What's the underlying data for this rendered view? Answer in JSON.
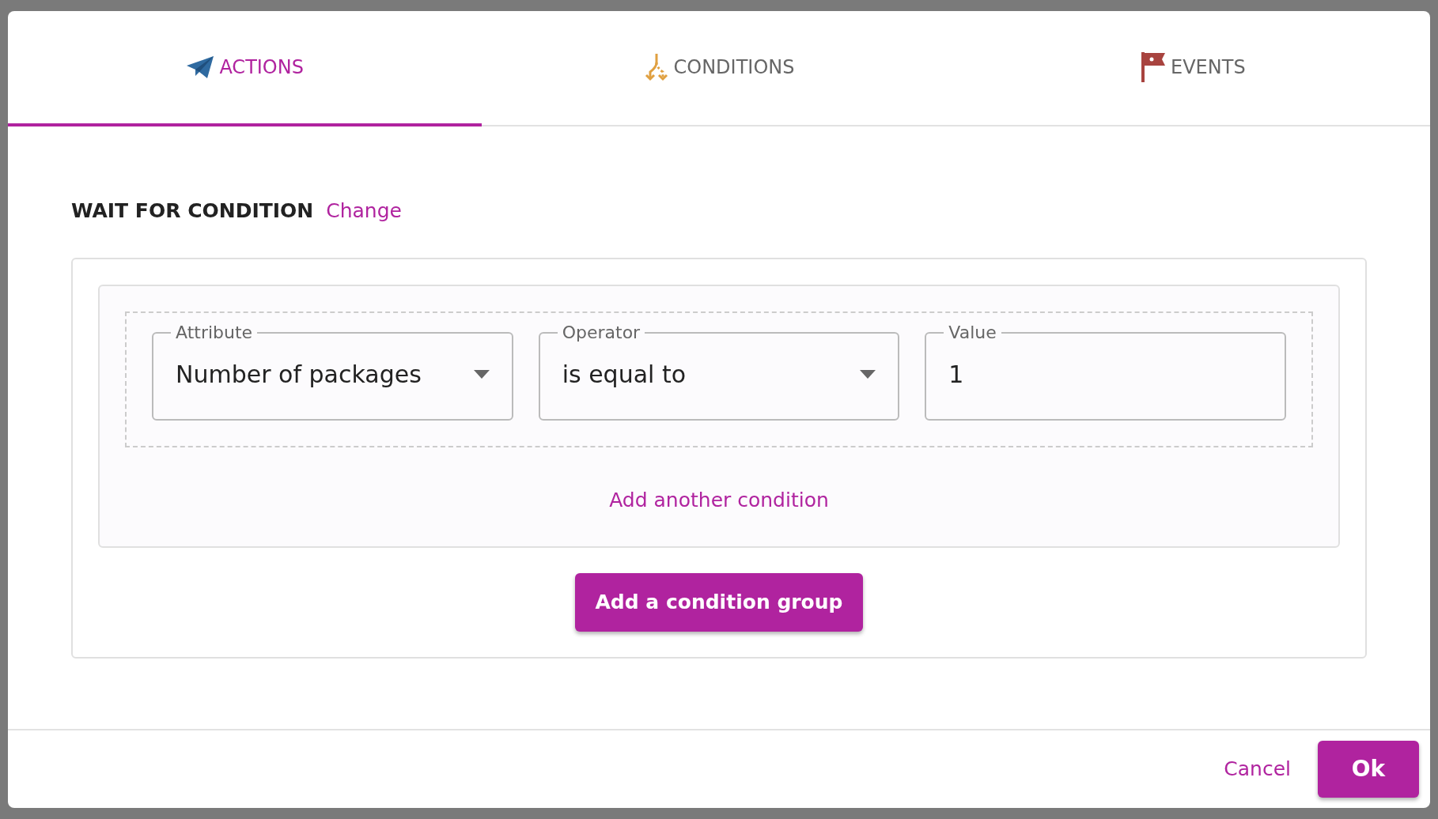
{
  "tabs": [
    {
      "label": "ACTIONS",
      "selected": true
    },
    {
      "label": "CONDITIONS",
      "selected": false
    },
    {
      "label": "EVENTS",
      "selected": false
    }
  ],
  "section": {
    "title": "WAIT FOR CONDITION",
    "link": "Change"
  },
  "condition_groups": [
    {
      "conditions": [
        {
          "fields": [
            {
              "kind": "select",
              "label": "Attribute",
              "value": "Number of packages"
            },
            {
              "kind": "select",
              "label": "Operator",
              "value": "is equal to"
            },
            {
              "kind": "text",
              "label": "Value",
              "value": "1"
            }
          ]
        }
      ],
      "add_condition": "Add another condition"
    }
  ],
  "add_group_button": "Add a condition group",
  "footer": {
    "cancel": "Cancel",
    "ok": "Ok"
  }
}
